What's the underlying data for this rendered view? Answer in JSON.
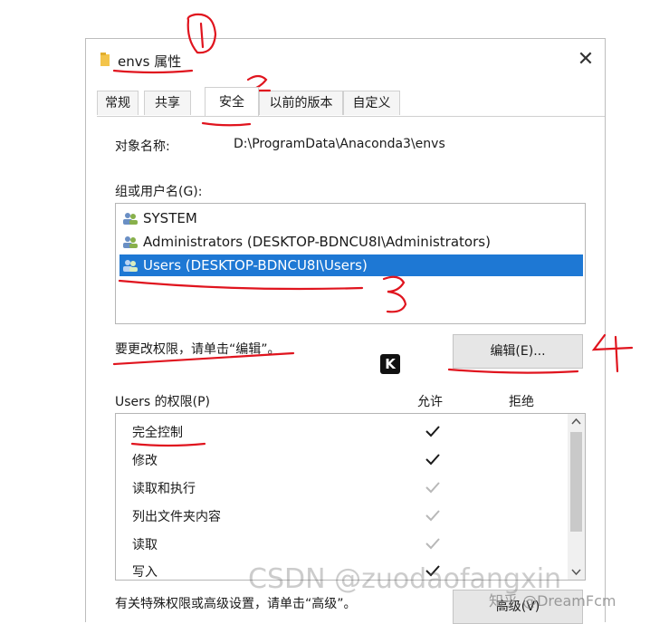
{
  "window": {
    "title": "envs 属性",
    "close_glyph": "✕",
    "tabs": [
      {
        "label": "常规",
        "active": false
      },
      {
        "label": "共享",
        "active": false
      },
      {
        "label": "安全",
        "active": true
      },
      {
        "label": "以前的版本",
        "active": false
      },
      {
        "label": "自定义",
        "active": false
      }
    ]
  },
  "security": {
    "object_name_label": "对象名称:",
    "object_name_value": "D:\\ProgramData\\Anaconda3\\envs",
    "group_label": "组或用户名(G):",
    "users": [
      {
        "name": "SYSTEM",
        "icon": "users-icon",
        "selected": false
      },
      {
        "name": "Administrators (DESKTOP-BDNCU8I\\Administrators)",
        "icon": "users-icon",
        "selected": true
      },
      {
        "name": "Users (DESKTOP-BDNCU8I\\Users)",
        "icon": "users-icon",
        "selected": true
      }
    ],
    "change_hint": "要更改权限，请单击“编辑”。",
    "edit_button": "编辑(E)...",
    "permissions_label": "Users 的权限(P)",
    "allow_label": "允许",
    "deny_label": "拒绝",
    "permissions": [
      {
        "name": "完全控制",
        "allow": true,
        "inherited": false
      },
      {
        "name": "修改",
        "allow": true,
        "inherited": false
      },
      {
        "name": "读取和执行",
        "allow": true,
        "inherited": true
      },
      {
        "name": "列出文件夹内容",
        "allow": true,
        "inherited": true
      },
      {
        "name": "读取",
        "allow": true,
        "inherited": true
      },
      {
        "name": "写入",
        "allow": true,
        "inherited": false
      }
    ],
    "advanced_hint": "有关特殊权限或高级设置，请单击“高级”。",
    "advanced_button": "高级(V)"
  },
  "overlay": {
    "k_badge": "K",
    "annotations": [
      "1",
      "2",
      "3",
      "4"
    ],
    "watermark": "CSDN @zuodaofangxin",
    "watermark2": "知乎 @DreamFcm"
  },
  "colors": {
    "selection": "#1e78d4",
    "annotation_red": "#e0141e",
    "check_active": "#1a1a1a",
    "check_inherited": "#b8b8b8"
  }
}
